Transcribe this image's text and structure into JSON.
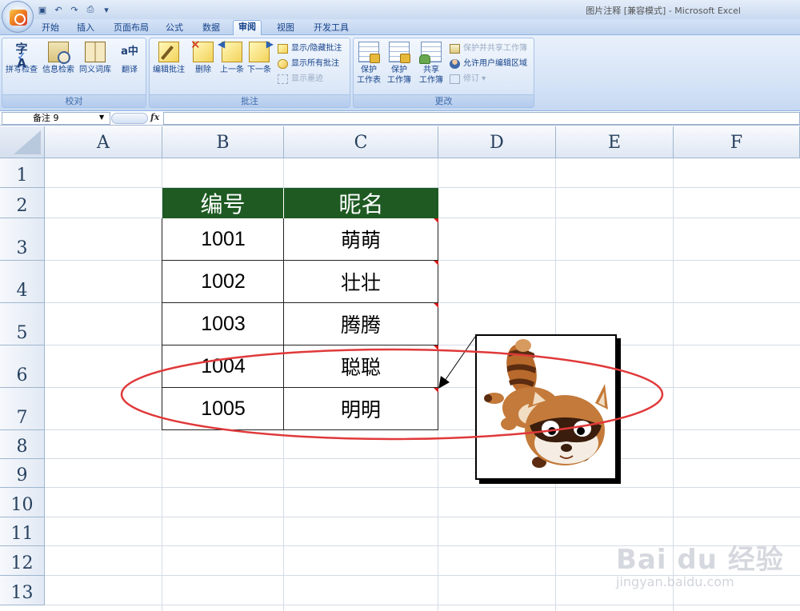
{
  "window": {
    "title": "图片注释  [兼容模式] - Microsoft Excel"
  },
  "qat": [
    "save-icon",
    "undo-icon",
    "redo-icon",
    "print-preview-icon",
    "customize-icon"
  ],
  "tabs": [
    {
      "label": "开始"
    },
    {
      "label": "插入"
    },
    {
      "label": "页面布局"
    },
    {
      "label": "公式"
    },
    {
      "label": "数据"
    },
    {
      "label": "审阅",
      "active": true
    },
    {
      "label": "视图"
    },
    {
      "label": "开发工具"
    }
  ],
  "ribbon": {
    "proofing": {
      "label": "校对",
      "buttons": [
        "拼写检查",
        "信息检索",
        "同义词库",
        "翻译"
      ]
    },
    "comments": {
      "label": "批注",
      "buttons": [
        "编辑批注",
        "删除",
        "上一条",
        "下一条"
      ],
      "small": [
        "显示/隐藏批注",
        "显示所有批注",
        "显示墨迹"
      ]
    },
    "changes": {
      "label": "更改",
      "buttons": [
        {
          "l1": "保护",
          "l2": "工作表"
        },
        {
          "l1": "保护",
          "l2": "工作簿"
        },
        {
          "l1": "共享",
          "l2": "工作簿"
        }
      ],
      "small": [
        "保护并共享工作簿",
        "允许用户编辑区域",
        "修订"
      ]
    }
  },
  "formula_bar": {
    "name_box": "备注 9",
    "fx": "fx",
    "value": ""
  },
  "sheet": {
    "columns": [
      "A",
      "B",
      "C",
      "D",
      "E",
      "F"
    ],
    "rows": [
      "1",
      "2",
      "3",
      "4",
      "5",
      "6",
      "7",
      "8",
      "9",
      "10",
      "11",
      "12",
      "13"
    ],
    "table": {
      "header": [
        "编号",
        "昵名"
      ],
      "rows": [
        [
          "1001",
          "萌萌"
        ],
        [
          "1002",
          "壮壮"
        ],
        [
          "1003",
          "腾腾"
        ],
        [
          "1004",
          "聪聪"
        ],
        [
          "1005",
          "明明"
        ]
      ],
      "header_color": "#1e5a22"
    },
    "comment_image": "raccoon-picture"
  },
  "annotation": {
    "color": "#e0393a"
  },
  "watermark": {
    "text": "Bai du 经验",
    "url": "jingyan.baidu.com"
  }
}
